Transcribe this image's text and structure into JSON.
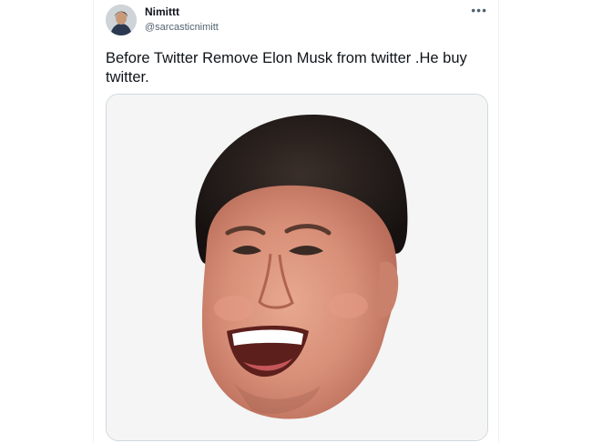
{
  "tweet": {
    "author_name": "Nimittt",
    "author_handle": "@sarcasticnimitt",
    "more_icon": "more-horizontal-icon",
    "text": "Before Twitter Remove Elon Musk from twitter .He buy twitter."
  },
  "colors": {
    "text": "#0f1419",
    "secondary": "#536471",
    "border": "#cfd9de",
    "media_bg": "#f5f5f5"
  }
}
